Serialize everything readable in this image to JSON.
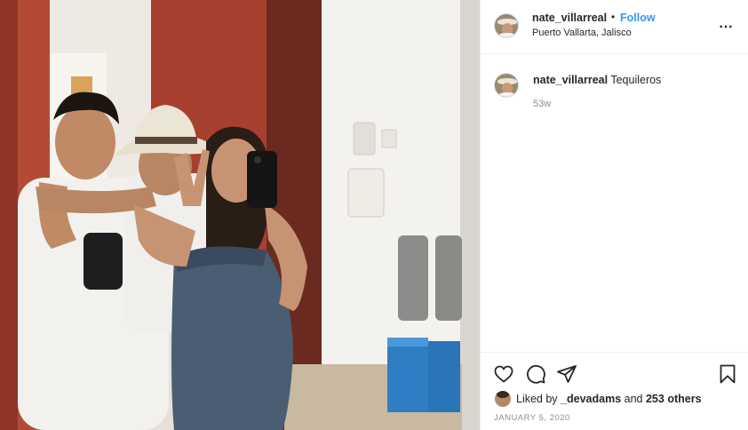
{
  "post": {
    "username": "nate_villarreal",
    "dot": "•",
    "follow_label": "Follow",
    "location": "Puerto Vallarta, Jalisco",
    "more_icon": "⋯"
  },
  "caption": {
    "username": "nate_villarreal",
    "text": "Tequileros",
    "age": "53w"
  },
  "actions": {
    "icons": [
      "heart-icon",
      "comment-icon",
      "share-icon",
      "bookmark-icon"
    ]
  },
  "likes": {
    "prefix": "Liked by",
    "user": "_devadams",
    "joiner": "and",
    "others": "253 others"
  },
  "date": "JANUARY 5, 2020",
  "colors": {
    "follow": "#3897f0",
    "text": "#262626",
    "muted": "#8e8e8e",
    "border": "#efefef"
  }
}
